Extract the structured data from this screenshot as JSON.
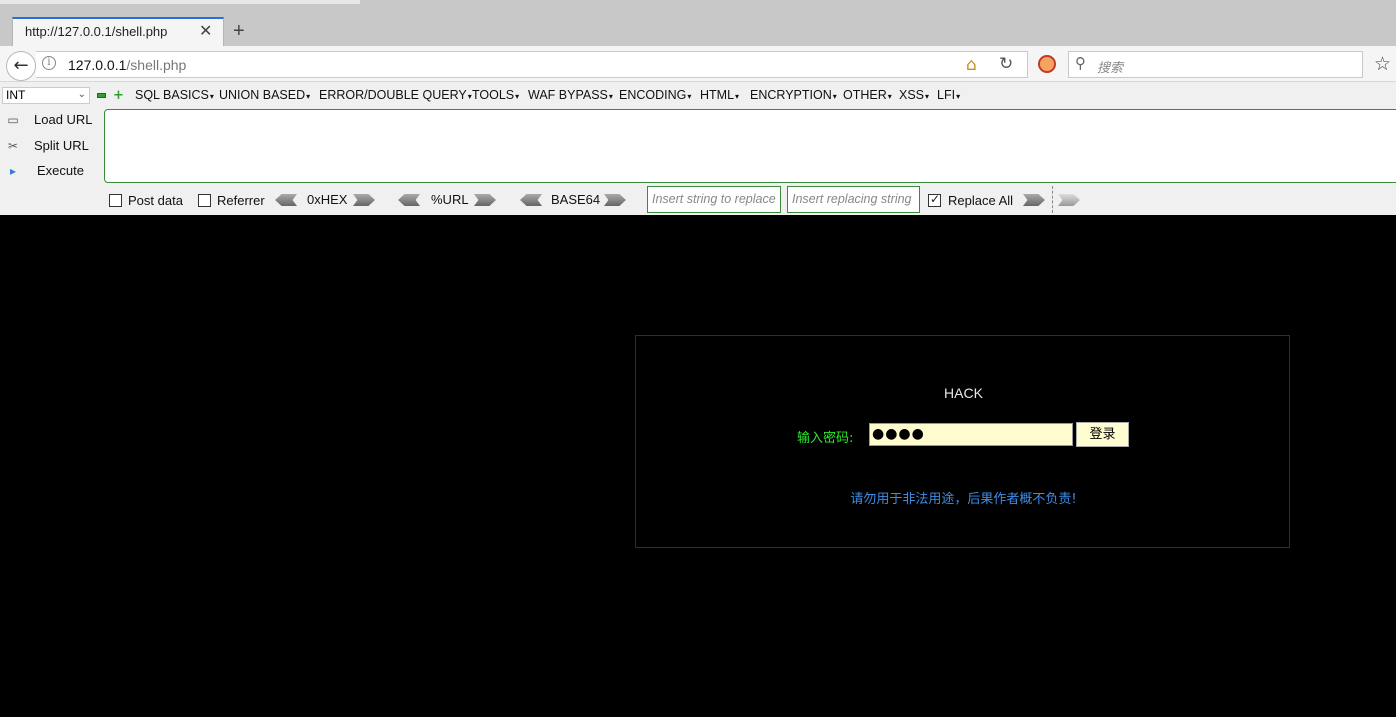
{
  "tab": {
    "title": "http://127.0.0.1/shell.php",
    "close": "✕",
    "new_tab": "+"
  },
  "nav": {
    "back": "←",
    "url_host": "127.0.0.1",
    "url_path": "/shell.php",
    "search_placeholder": "搜索"
  },
  "hackbar": {
    "int_select": "INT",
    "menus": [
      "SQL BASICS",
      "UNION BASED",
      "ERROR/DOUBLE QUERY",
      "TOOLS",
      "WAF BYPASS",
      "ENCODING",
      "HTML",
      "ENCRYPTION",
      "OTHER",
      "XSS",
      "LFI"
    ],
    "load_url": "Load URL",
    "split_url": "Split URL",
    "execute": "Execute",
    "post_data": "Post data",
    "referrer": "Referrer",
    "hex": "0xHEX",
    "url_enc": "%URL",
    "base64": "BASE64",
    "replace_placeholder": "Insert string to replace",
    "replacing_placeholder": "Insert replacing string",
    "replace_all": "Replace All",
    "replace_all_checked": true
  },
  "page": {
    "title": "HACK",
    "password_label": "输入密码:",
    "password_value": "●●●●",
    "login_button": "登录",
    "warning": "请勿用于非法用途，后果作者概不负责!"
  },
  "colors": {
    "page_bg": "#000000",
    "label_green": "#2ee82e",
    "warning_blue": "#3e8ce6",
    "input_bg": "#fffdd0"
  }
}
